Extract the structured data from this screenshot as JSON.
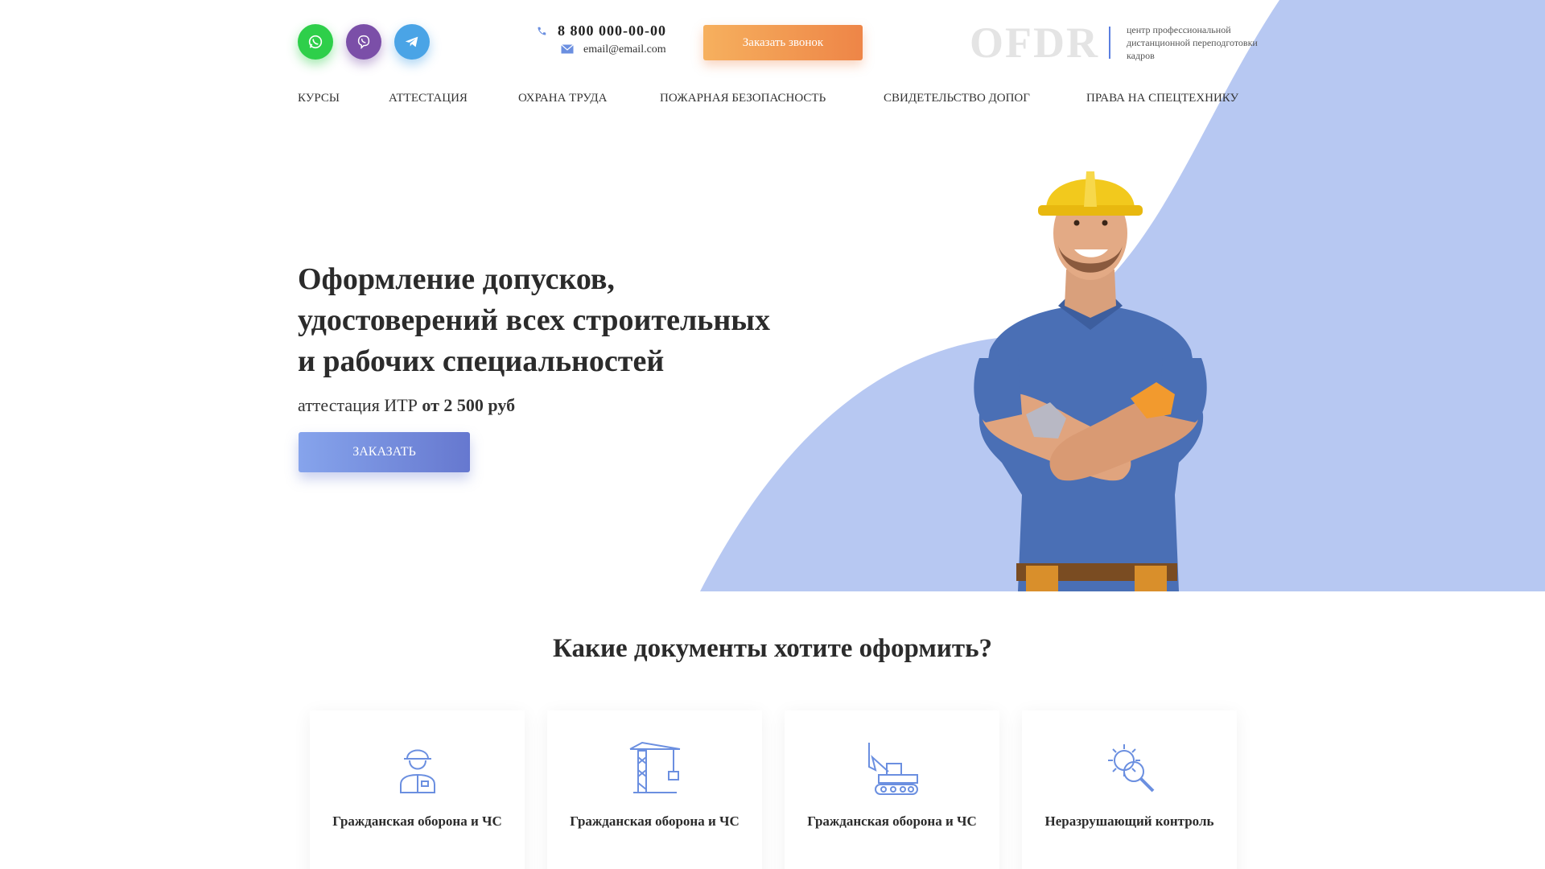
{
  "header": {
    "phone": "8 800 000-00-00",
    "email": "email@email.com",
    "callback_label": "Заказать звонок",
    "logo_text": "OFDR",
    "logo_subtitle": "центр профессиональной дистанционной переподготовки кадров"
  },
  "social": [
    "whatsapp-icon",
    "viber-icon",
    "telegram-icon"
  ],
  "nav": {
    "items": [
      "КУРСЫ",
      "АТТЕСТАЦИЯ",
      "ОХРАНА ТРУДА",
      "ПОЖАРНАЯ БЕЗОПАСНОСТЬ",
      "СВИДЕТЕЛЬСТВО ДОПОГ",
      "ПРАВА НА СПЕЦТЕХНИКУ"
    ]
  },
  "hero": {
    "title_line1": "Оформление допусков,",
    "title_line2": "удостоверений всех строительных",
    "title_line3": "и рабочих специальностей",
    "subtitle_prefix": "аттестация ИТР",
    "subtitle_price": "от 2 500 руб",
    "order_label": "ЗАКАЗАТЬ"
  },
  "documents": {
    "title": "Какие документы хотите оформить?",
    "cards": [
      {
        "label": "Гражданская оборона и ЧС",
        "icon": "worker-helmet-icon"
      },
      {
        "label": "Гражданская оборона и ЧС",
        "icon": "crane-icon"
      },
      {
        "label": "Гражданская оборона и ЧС",
        "icon": "excavator-icon"
      },
      {
        "label": "Неразрушающий контроль",
        "icon": "gear-magnifier-icon"
      }
    ]
  },
  "colors": {
    "accent_blue": "#b7c8f2",
    "callback_orange": "#ee8547",
    "order_blue": "#6678cf"
  }
}
